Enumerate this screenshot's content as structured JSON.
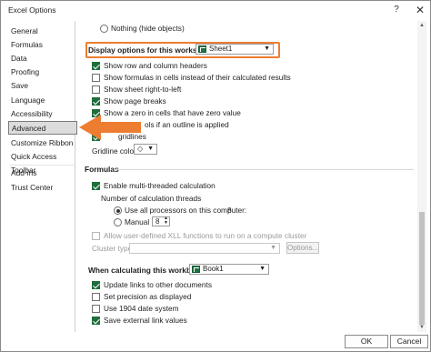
{
  "window": {
    "title": "Excel Options",
    "help_glyph": "?",
    "close_glyph": "✕"
  },
  "sidebar": {
    "items": [
      {
        "label": "General"
      },
      {
        "label": "Formulas"
      },
      {
        "label": "Data"
      },
      {
        "label": "Proofing"
      },
      {
        "label": "Save"
      },
      {
        "label": "Language"
      },
      {
        "label": "Accessibility"
      },
      {
        "label": "Advanced"
      },
      {
        "label": "Customize Ribbon"
      },
      {
        "label": "Quick Access Toolbar"
      },
      {
        "label": "Add-ins"
      },
      {
        "label": "Trust Center"
      }
    ],
    "active": "Advanced"
  },
  "content": {
    "nothing_option": "Nothing (hide objects)",
    "worksheet_label": "Display options for this worksheet:",
    "worksheet_value": "Sheet1",
    "worksheet_options": [
      {
        "label": "Show row and column headers",
        "checked": true
      },
      {
        "label": "Show formulas in cells instead of their calculated results",
        "checked": false
      },
      {
        "label": "Show sheet right-to-left",
        "checked": false
      },
      {
        "label": "Show page breaks",
        "checked": true
      },
      {
        "label": "Show a zero in cells that have zero value",
        "checked": true
      },
      {
        "label": "ols if an outline is applied",
        "checked": true
      },
      {
        "label": "gridlines",
        "checked": true
      }
    ],
    "gridline_color_label": "Gridline color",
    "formulas_heading": "Formulas",
    "multithread_label": "Enable multi-threaded calculation",
    "threads_label": "Number of calculation threads",
    "all_processors_label": "Use all processors on this computer:",
    "all_processors_value": "8",
    "manual_label": "Manual",
    "manual_value": "8",
    "xll_label": "Allow user-defined XLL functions to run on a compute cluster",
    "cluster_type_label": "Cluster type:",
    "options_button": "Options...",
    "workbook_label": "When calculating this workbook:",
    "workbook_value": "Book1",
    "workbook_options": [
      {
        "label": "Update links to other documents",
        "checked": true
      },
      {
        "label": "Set precision as displayed",
        "checked": false
      },
      {
        "label": "Use 1904 date system",
        "checked": false
      },
      {
        "label": "Save external link values",
        "checked": true
      }
    ]
  },
  "footer": {
    "ok": "OK",
    "cancel": "Cancel"
  },
  "colors": {
    "highlight": "#ed7d31",
    "checkbox": "#1f6e3b"
  }
}
